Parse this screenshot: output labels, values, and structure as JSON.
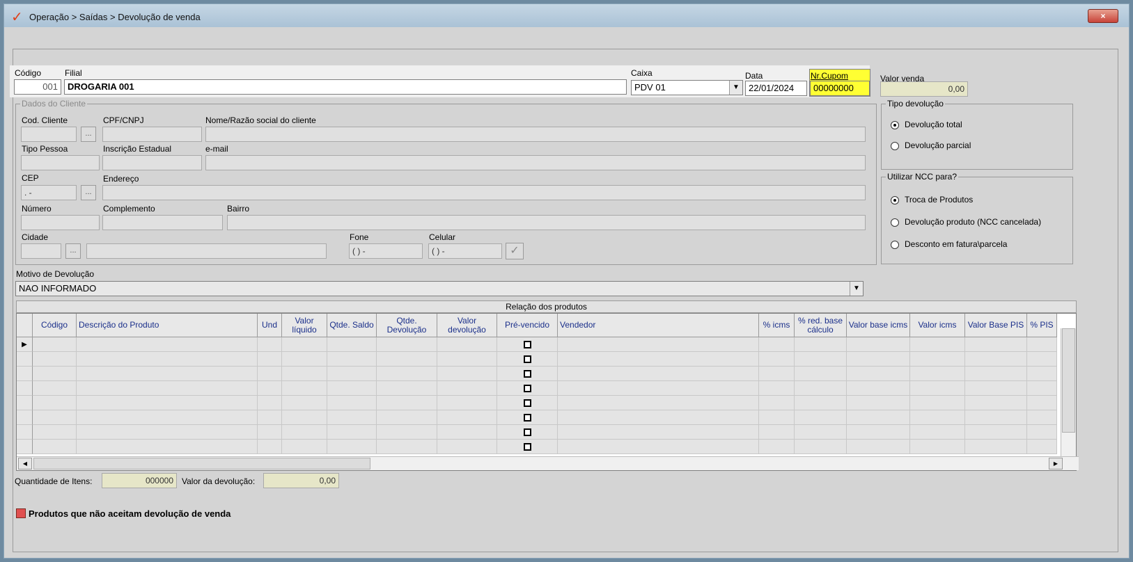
{
  "window": {
    "title": "Operação > Saídas > Devolução de venda",
    "close_label": "×"
  },
  "header": {
    "codigo_label": "Código",
    "codigo_value": "001",
    "filial_label": "Filial",
    "filial_value": "DROGARIA 001",
    "caixa_label": "Caixa",
    "caixa_value": "PDV 01",
    "data_label": "Data",
    "data_value": "22/01/2024",
    "cupom_label": "Nr.Cupom",
    "cupom_value": "00000000",
    "valor_venda_label": "Valor venda",
    "valor_venda_value": "0,00"
  },
  "cliente": {
    "group_title": "Dados do Cliente",
    "cod_cliente_label": "Cod. Cliente",
    "cpf_label": "CPF/CNPJ",
    "nome_label": "Nome/Razão social do cliente",
    "tipo_pessoa_label": "Tipo Pessoa",
    "inscricao_label": "Inscrição Estadual",
    "email_label": "e-mail",
    "cep_label": "CEP",
    "cep_value": " .  -",
    "endereco_label": "Endereço",
    "numero_label": "Número",
    "complemento_label": "Complemento",
    "bairro_label": "Bairro",
    "cidade_label": "Cidade",
    "fone_label": "Fone",
    "fone_value": "( )    -",
    "celular_label": "Celular",
    "celular_value": "( )    -",
    "lookup_label": "...",
    "confirm_icon": "✓"
  },
  "tipo_devolucao": {
    "title": "Tipo devolução",
    "options": [
      "Devolução total",
      "Devolução parcial"
    ],
    "selected": 0
  },
  "ncc": {
    "title": "Utilizar NCC para?",
    "options": [
      "Troca de Produtos",
      "Devolução produto (NCC cancelada)",
      "Desconto em fatura\\parcela"
    ],
    "selected": 0
  },
  "motivo": {
    "label": "Motivo de Devolução",
    "value": "NAO INFORMADO"
  },
  "grid": {
    "title": "Relação dos produtos",
    "columns": [
      "Código",
      "Descrição do Produto",
      "Und",
      "Valor líquido",
      "Qtde. Saldo",
      "Qtde. Devolução",
      "Valor devolução",
      "Pré-vencido",
      "Vendedor",
      "% icms",
      "% red. base cálculo",
      "Valor base icms",
      "Valor icms",
      "Valor Base PIS",
      "% PIS"
    ],
    "row_count": 8
  },
  "footer": {
    "qtd_itens_label": "Quantidade de Itens:",
    "qtd_itens_value": "000000",
    "valor_devolucao_label": "Valor da devolução:",
    "valor_devolucao_value": "0,00",
    "legend_label": "Produtos que não aceitam devolução de venda",
    "legend_color": "#e05050"
  }
}
